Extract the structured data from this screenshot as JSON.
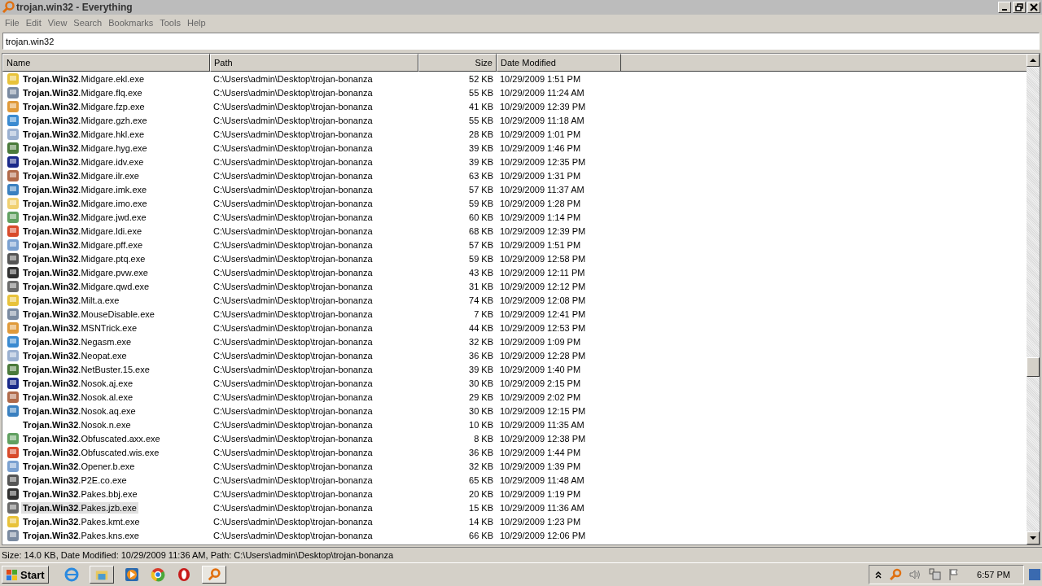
{
  "window": {
    "title": "trojan.win32 - Everything"
  },
  "menu": [
    "File",
    "Edit",
    "View",
    "Search",
    "Bookmarks",
    "Tools",
    "Help"
  ],
  "search": {
    "value": "trojan.win32"
  },
  "table": {
    "columns": [
      "Name",
      "Path",
      "Size",
      "Date Modified"
    ],
    "rows": [
      {
        "name": "**Trojan.Win32**.Midgare.ekl.exe",
        "path": "C:\\Users\\admin\\Desktop\\trojan-bonanza",
        "size": "52 KB",
        "date": "10/29/2009 1:51 PM",
        "has_icon": true,
        "selected": false
      },
      {
        "name": "**Trojan.Win32**.Midgare.flq.exe",
        "path": "C:\\Users\\admin\\Desktop\\trojan-bonanza",
        "size": "55 KB",
        "date": "10/29/2009 11:24 AM",
        "has_icon": true,
        "selected": false
      },
      {
        "name": "**Trojan.Win32**.Midgare.fzp.exe",
        "path": "C:\\Users\\admin\\Desktop\\trojan-bonanza",
        "size": "41 KB",
        "date": "10/29/2009 12:39 PM",
        "has_icon": true,
        "selected": false
      },
      {
        "name": "**Trojan.Win32**.Midgare.gzh.exe",
        "path": "C:\\Users\\admin\\Desktop\\trojan-bonanza",
        "size": "55 KB",
        "date": "10/29/2009 11:18 AM",
        "has_icon": true,
        "selected": false
      },
      {
        "name": "**Trojan.Win32**.Midgare.hkl.exe",
        "path": "C:\\Users\\admin\\Desktop\\trojan-bonanza",
        "size": "28 KB",
        "date": "10/29/2009 1:01 PM",
        "has_icon": true,
        "selected": false
      },
      {
        "name": "**Trojan.Win32**.Midgare.hyg.exe",
        "path": "C:\\Users\\admin\\Desktop\\trojan-bonanza",
        "size": "39 KB",
        "date": "10/29/2009 1:46 PM",
        "has_icon": true,
        "selected": false
      },
      {
        "name": "**Trojan.Win32**.Midgare.idv.exe",
        "path": "C:\\Users\\admin\\Desktop\\trojan-bonanza",
        "size": "39 KB",
        "date": "10/29/2009 12:35 PM",
        "has_icon": true,
        "selected": false
      },
      {
        "name": "**Trojan.Win32**.Midgare.ilr.exe",
        "path": "C:\\Users\\admin\\Desktop\\trojan-bonanza",
        "size": "63 KB",
        "date": "10/29/2009 1:31 PM",
        "has_icon": true,
        "selected": false
      },
      {
        "name": "**Trojan.Win32**.Midgare.imk.exe",
        "path": "C:\\Users\\admin\\Desktop\\trojan-bonanza",
        "size": "57 KB",
        "date": "10/29/2009 11:37 AM",
        "has_icon": true,
        "selected": false
      },
      {
        "name": "**Trojan.Win32**.Midgare.imo.exe",
        "path": "C:\\Users\\admin\\Desktop\\trojan-bonanza",
        "size": "59 KB",
        "date": "10/29/2009 1:28 PM",
        "has_icon": true,
        "selected": false
      },
      {
        "name": "**Trojan.Win32**.Midgare.jwd.exe",
        "path": "C:\\Users\\admin\\Desktop\\trojan-bonanza",
        "size": "60 KB",
        "date": "10/29/2009 1:14 PM",
        "has_icon": true,
        "selected": false
      },
      {
        "name": "**Trojan.Win32**.Midgare.ldi.exe",
        "path": "C:\\Users\\admin\\Desktop\\trojan-bonanza",
        "size": "68 KB",
        "date": "10/29/2009 12:39 PM",
        "has_icon": true,
        "selected": false
      },
      {
        "name": "**Trojan.Win32**.Midgare.pff.exe",
        "path": "C:\\Users\\admin\\Desktop\\trojan-bonanza",
        "size": "57 KB",
        "date": "10/29/2009 1:51 PM",
        "has_icon": true,
        "selected": false
      },
      {
        "name": "**Trojan.Win32**.Midgare.ptq.exe",
        "path": "C:\\Users\\admin\\Desktop\\trojan-bonanza",
        "size": "59 KB",
        "date": "10/29/2009 12:58 PM",
        "has_icon": true,
        "selected": false
      },
      {
        "name": "**Trojan.Win32**.Midgare.pvw.exe",
        "path": "C:\\Users\\admin\\Desktop\\trojan-bonanza",
        "size": "43 KB",
        "date": "10/29/2009 12:11 PM",
        "has_icon": true,
        "selected": false
      },
      {
        "name": "**Trojan.Win32**.Midgare.qwd.exe",
        "path": "C:\\Users\\admin\\Desktop\\trojan-bonanza",
        "size": "31 KB",
        "date": "10/29/2009 12:12 PM",
        "has_icon": true,
        "selected": false
      },
      {
        "name": "**Trojan.Win32**.Milt.a.exe",
        "path": "C:\\Users\\admin\\Desktop\\trojan-bonanza",
        "size": "74 KB",
        "date": "10/29/2009 12:08 PM",
        "has_icon": true,
        "selected": false
      },
      {
        "name": "**Trojan.Win32**.MouseDisable.exe",
        "path": "C:\\Users\\admin\\Desktop\\trojan-bonanza",
        "size": "7 KB",
        "date": "10/29/2009 12:41 PM",
        "has_icon": true,
        "selected": false
      },
      {
        "name": "**Trojan.Win32**.MSNTrick.exe",
        "path": "C:\\Users\\admin\\Desktop\\trojan-bonanza",
        "size": "44 KB",
        "date": "10/29/2009 12:53 PM",
        "has_icon": true,
        "selected": false
      },
      {
        "name": "**Trojan.Win32**.Negasm.exe",
        "path": "C:\\Users\\admin\\Desktop\\trojan-bonanza",
        "size": "32 KB",
        "date": "10/29/2009 1:09 PM",
        "has_icon": true,
        "selected": false
      },
      {
        "name": "**Trojan.Win32**.Neopat.exe",
        "path": "C:\\Users\\admin\\Desktop\\trojan-bonanza",
        "size": "36 KB",
        "date": "10/29/2009 12:28 PM",
        "has_icon": true,
        "selected": false
      },
      {
        "name": "**Trojan.Win32**.NetBuster.15.exe",
        "path": "C:\\Users\\admin\\Desktop\\trojan-bonanza",
        "size": "39 KB",
        "date": "10/29/2009 1:40 PM",
        "has_icon": true,
        "selected": false
      },
      {
        "name": "**Trojan.Win32**.Nosok.aj.exe",
        "path": "C:\\Users\\admin\\Desktop\\trojan-bonanza",
        "size": "30 KB",
        "date": "10/29/2009 2:15 PM",
        "has_icon": true,
        "selected": false
      },
      {
        "name": "**Trojan.Win32**.Nosok.al.exe",
        "path": "C:\\Users\\admin\\Desktop\\trojan-bonanza",
        "size": "29 KB",
        "date": "10/29/2009 2:02 PM",
        "has_icon": true,
        "selected": false
      },
      {
        "name": "**Trojan.Win32**.Nosok.aq.exe",
        "path": "C:\\Users\\admin\\Desktop\\trojan-bonanza",
        "size": "30 KB",
        "date": "10/29/2009 12:15 PM",
        "has_icon": true,
        "selected": false
      },
      {
        "name": "**Trojan.Win32**.Nosok.n.exe",
        "path": "C:\\Users\\admin\\Desktop\\trojan-bonanza",
        "size": "10 KB",
        "date": "10/29/2009 11:35 AM",
        "has_icon": false,
        "selected": false
      },
      {
        "name": "**Trojan.Win32**.Obfuscated.axx.exe",
        "path": "C:\\Users\\admin\\Desktop\\trojan-bonanza",
        "size": "8 KB",
        "date": "10/29/2009 12:38 PM",
        "has_icon": true,
        "selected": false
      },
      {
        "name": "**Trojan.Win32**.Obfuscated.wis.exe",
        "path": "C:\\Users\\admin\\Desktop\\trojan-bonanza",
        "size": "36 KB",
        "date": "10/29/2009 1:44 PM",
        "has_icon": true,
        "selected": false
      },
      {
        "name": "**Trojan.Win32**.Opener.b.exe",
        "path": "C:\\Users\\admin\\Desktop\\trojan-bonanza",
        "size": "32 KB",
        "date": "10/29/2009 1:39 PM",
        "has_icon": true,
        "selected": false
      },
      {
        "name": "**Trojan.Win32**.P2E.co.exe",
        "path": "C:\\Users\\admin\\Desktop\\trojan-bonanza",
        "size": "65 KB",
        "date": "10/29/2009 11:48 AM",
        "has_icon": true,
        "selected": false
      },
      {
        "name": "**Trojan.Win32**.Pakes.bbj.exe",
        "path": "C:\\Users\\admin\\Desktop\\trojan-bonanza",
        "size": "20 KB",
        "date": "10/29/2009 1:19 PM",
        "has_icon": true,
        "selected": false
      },
      {
        "name": "**Trojan.Win32**.Pakes.jzb.exe",
        "path": "C:\\Users\\admin\\Desktop\\trojan-bonanza",
        "size": "15 KB",
        "date": "10/29/2009 11:36 AM",
        "has_icon": true,
        "selected": true
      },
      {
        "name": "**Trojan.Win32**.Pakes.kmt.exe",
        "path": "C:\\Users\\admin\\Desktop\\trojan-bonanza",
        "size": "14 KB",
        "date": "10/29/2009 1:23 PM",
        "has_icon": true,
        "selected": false
      },
      {
        "name": "**Trojan.Win32**.Pakes.kns.exe",
        "path": "C:\\Users\\admin\\Desktop\\trojan-bonanza",
        "size": "66 KB",
        "date": "10/29/2009 12:06 PM",
        "has_icon": true,
        "selected": false
      }
    ]
  },
  "status_bar": "Size: 14.0 KB, Date Modified: 10/29/2009 11:36 AM, Path: C:\\Users\\admin\\Desktop\\trojan-bonanza",
  "taskbar": {
    "start": "Start",
    "clock": "6:57 PM"
  }
}
